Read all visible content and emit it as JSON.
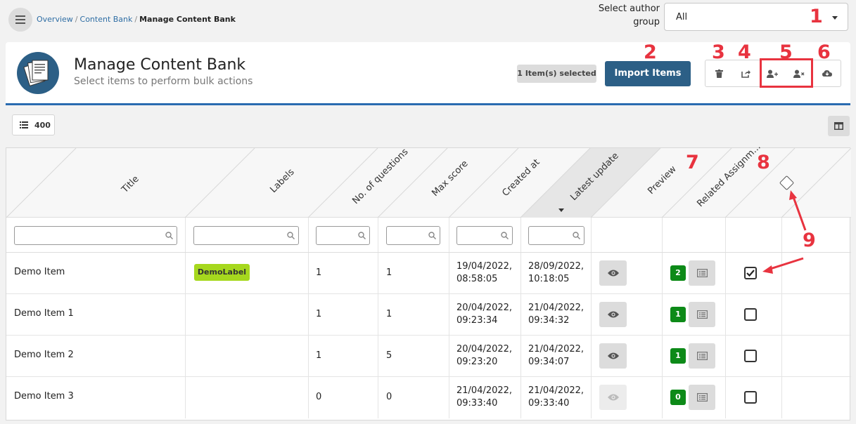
{
  "breadcrumb": {
    "items": [
      "Overview",
      "Content Bank"
    ],
    "separator": "/",
    "current": "Manage Content Bank"
  },
  "author_group": {
    "label": "Select author group",
    "value": "All"
  },
  "header": {
    "title": "Manage Content Bank",
    "subtitle": "Select items to perform bulk actions",
    "selected_badge": "1 Item(s) selected",
    "import_button": "Import Items"
  },
  "toolbar_icons": [
    "trash-icon",
    "share-icon",
    "user-plus-icon",
    "user-remove-icon",
    "cloud-download-icon"
  ],
  "list_count": "400",
  "annotations": [
    "1",
    "2",
    "3",
    "4",
    "5",
    "6",
    "7",
    "8",
    "9"
  ],
  "table": {
    "columns": [
      "Title",
      "Labels",
      "No. of questions",
      "Max score",
      "Created at",
      "Latest update",
      "Preview",
      "Related Assignm..."
    ],
    "sorted_column": "Latest update",
    "rows": [
      {
        "title": "Demo Item",
        "label": "DemoLabel",
        "questions": "1",
        "max_score": "1",
        "created_date": "19/04/2022,",
        "created_time": "08:58:05",
        "updated_date": "28/09/2022,",
        "updated_time": "10:18:05",
        "assignments": "2",
        "selected": true,
        "preview_enabled": true
      },
      {
        "title": "Demo Item 1",
        "label": "",
        "questions": "1",
        "max_score": "1",
        "created_date": "20/04/2022,",
        "created_time": "09:23:34",
        "updated_date": "21/04/2022,",
        "updated_time": "09:34:32",
        "assignments": "1",
        "selected": false,
        "preview_enabled": true
      },
      {
        "title": "Demo Item 2",
        "label": "",
        "questions": "1",
        "max_score": "5",
        "created_date": "20/04/2022,",
        "created_time": "09:23:20",
        "updated_date": "21/04/2022,",
        "updated_time": "09:34:07",
        "assignments": "1",
        "selected": false,
        "preview_enabled": true
      },
      {
        "title": "Demo Item 3",
        "label": "",
        "questions": "0",
        "max_score": "0",
        "created_date": "21/04/2022,",
        "created_time": "09:33:40",
        "updated_date": "21/04/2022,",
        "updated_time": "09:33:40",
        "assignments": "0",
        "selected": false,
        "preview_enabled": false
      }
    ]
  },
  "colors": {
    "primary": "#2c5f86",
    "accent_line": "#2a6bb0",
    "label_green": "#a6d81e",
    "badge_green": "#0d8a18",
    "annotation_red": "#e8333f"
  }
}
